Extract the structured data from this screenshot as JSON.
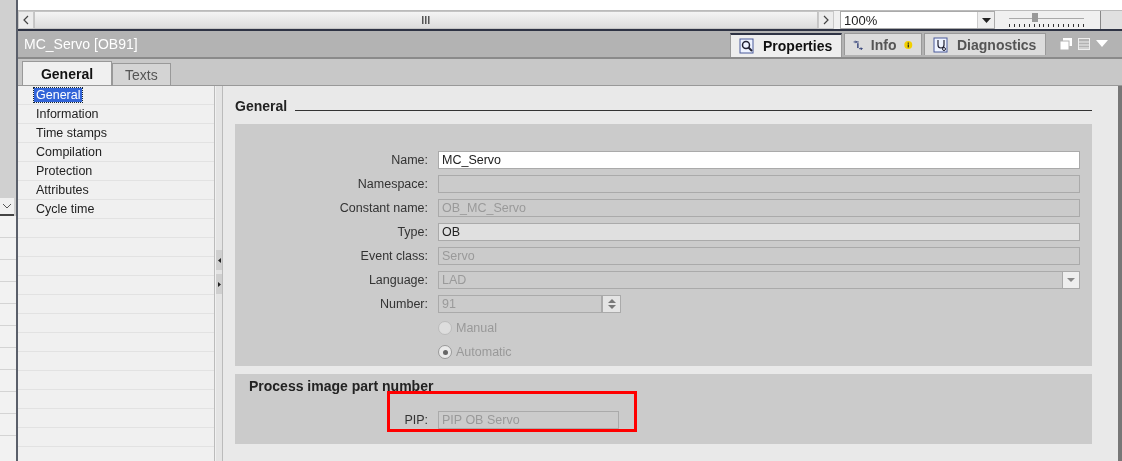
{
  "toolbar": {
    "zoom": "100%",
    "slider": {
      "level": 0.35
    }
  },
  "panel": {
    "title": "MC_Servo [OB91]",
    "inspector_tabs": [
      {
        "label": "Properties",
        "selected": true,
        "badge": false
      },
      {
        "label": "Info",
        "selected": false,
        "badge": true
      },
      {
        "label": "Diagnostics",
        "selected": false,
        "badge": false
      }
    ]
  },
  "tabs": [
    {
      "label": "General",
      "selected": true
    },
    {
      "label": "Texts",
      "selected": false
    }
  ],
  "sidebar": {
    "items": [
      {
        "label": "General",
        "selected": true
      },
      {
        "label": "Information",
        "selected": false
      },
      {
        "label": "Time stamps",
        "selected": false
      },
      {
        "label": "Compilation",
        "selected": false
      },
      {
        "label": "Protection",
        "selected": false
      },
      {
        "label": "Attributes",
        "selected": false
      },
      {
        "label": "Cycle time",
        "selected": false
      }
    ]
  },
  "general": {
    "heading": "General",
    "fields": [
      {
        "kind": "input",
        "label": "Name:",
        "value": "MC_Servo",
        "disabled": false,
        "readonly": false
      },
      {
        "kind": "input",
        "label": "Namespace:",
        "disabled": true,
        "readonly": false
      },
      {
        "kind": "input",
        "label": "Constant name:",
        "value": "OB_MC_Servo",
        "disabled": true,
        "readonly": false
      },
      {
        "kind": "input",
        "label": "Type:",
        "value": "OB",
        "disabled": false,
        "readonly": true
      },
      {
        "kind": "input",
        "label": "Event class:",
        "value": "Servo",
        "disabled": true,
        "readonly": false
      },
      {
        "kind": "dropdown",
        "label": "Language:",
        "value": "LAD",
        "disabled": true
      },
      {
        "kind": "spinner",
        "label": "Number:",
        "value": "91",
        "disabled": true
      },
      {
        "kind": "radio",
        "label": "Manual",
        "selected": false,
        "disabled": true
      },
      {
        "kind": "radio",
        "label": "Automatic",
        "selected": true,
        "disabled": true
      }
    ]
  },
  "process_image": {
    "heading": "Process image part number",
    "field": {
      "label": "PIP:",
      "value": "PIP OB Servo",
      "disabled": true,
      "highlighted": true
    }
  }
}
